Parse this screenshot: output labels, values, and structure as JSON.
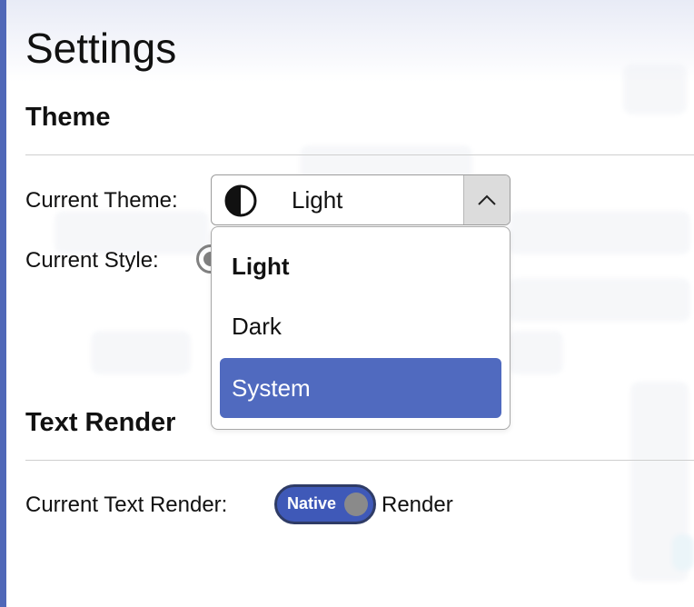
{
  "page": {
    "title": "Settings"
  },
  "theme_section": {
    "heading": "Theme",
    "current_theme_label": "Current Theme:",
    "current_theme_value": "Light",
    "current_style_label": "Current Style:"
  },
  "theme_dropdown": {
    "options": [
      {
        "label": "Light",
        "emphasized": true,
        "highlighted": false
      },
      {
        "label": "Dark",
        "emphasized": false,
        "highlighted": false
      },
      {
        "label": "System",
        "emphasized": false,
        "highlighted": true
      }
    ]
  },
  "text_render_section": {
    "heading": "Text Render",
    "current_text_render_label": "Current Text Render:",
    "toggle_label": "Native",
    "toggle_on": true,
    "after_toggle_text": "Render"
  },
  "colors": {
    "accent": "#506abf",
    "toggle_bg": "#3f59b8",
    "window_edge": "#5068b8"
  },
  "icons": {
    "theme": "half-circle-contrast-icon",
    "select_arrow": "chevron-up-icon"
  }
}
